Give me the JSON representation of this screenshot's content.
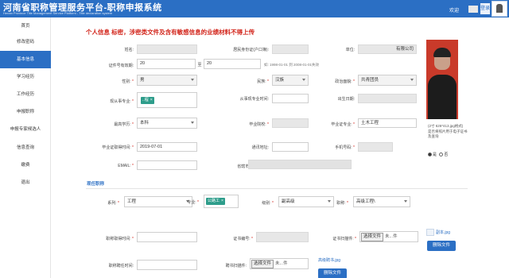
{
  "header": {
    "title": "河南省职称管理服务平台-职称申报系统",
    "subtitle": "Henan Province Title Management Service Platform - Title declaration system",
    "welcome": "欢迎",
    "logout": "登录"
  },
  "sidebar": {
    "items": [
      "首页",
      "修改密码",
      "基本信息",
      "学习经历",
      "工作经历",
      "申报职称",
      "申报专家候选人",
      "信息查询",
      "缴费",
      "退出"
    ],
    "active_index": 2
  },
  "main": {
    "title": "个人信息",
    "warning": "标密，涉密类文件及含有敏感信息的业绩材料不得上传"
  },
  "form": {
    "name_label": "姓名:",
    "id_label": "居民身份证(户口簿):",
    "unit_label": "单位:",
    "unit_value": "有限公司",
    "cert_validity_label": "证件号有效期:",
    "cert_start": "20",
    "cert_to": "至",
    "cert_end": "20",
    "cert_example": "如: 1998-01-01 到 2008-01-01失效",
    "gender_label": "性别:",
    "gender_value": "男",
    "ethnicity_label": "民族:",
    "ethnicity_value": "汉族",
    "political_label": "政治面貌:",
    "political_value": "共青团员",
    "current_major_label": "现从事专业:",
    "current_major_tag": "..程",
    "engaged_time_label": "从事现专业时间:",
    "birthdate_label": "出生日期:",
    "education_label": "最高学历:",
    "education_value": "本科",
    "school_label": "毕业院校:",
    "major_label": "毕业证专业:",
    "major_value": "土木工程",
    "grad_date_label": "毕业证取得时间:",
    "grad_date_value": "2019-07-01",
    "address_label": "通讯地址:",
    "phone_label": "手机号码:",
    "email_label": "EMAIL:",
    "province_label": "省辖市（省直）:"
  },
  "photo": {
    "note": "(2寸 626*413.jpg格式) 是否将照片用于电子证书及查询",
    "yes": "是",
    "no": "否"
  },
  "current_title": {
    "section": "现任职称",
    "series_label": "系列:",
    "series_value": "工程",
    "specialty_label": "专业:",
    "specialty_tag": "公路工",
    "level_label": "级别:",
    "level_value": "副高级",
    "title_label": "职称:",
    "title_value": "高级工程\\",
    "obtain_time_label": "职称取得时间:",
    "cert_no_label": "证书编号:",
    "cert_scan_label": "证书扫描件:",
    "file_btn": "选择文件",
    "file_none": "未...件",
    "sub_image_link": "副本.jpg",
    "delete_file_btn": "删除文件",
    "appoint_time_label": "职称聘任时间:",
    "appoint_scan_label": "聘书扫描件:",
    "appoint_file_none": "未...件",
    "appoint_link": "高级聘书.jpg",
    "appoint_delete_btn": "删除文件"
  }
}
